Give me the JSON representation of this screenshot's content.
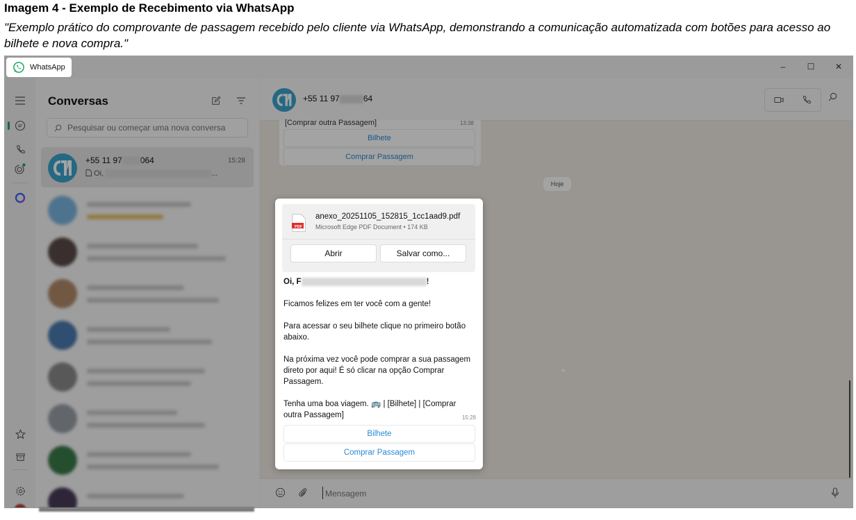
{
  "document": {
    "title": "Imagem 4 - Exemplo de Recebimento via WhatsApp",
    "caption": "\"Exemplo prático do comprovante de passagem recebido pelo cliente via WhatsApp, demonstrando a comunicação automatizada com botões para acesso ao bilhete e nova compra.\""
  },
  "window": {
    "app_name": "WhatsApp",
    "controls": {
      "minimize": "–",
      "maximize": "☐",
      "close": "✕"
    }
  },
  "sidebar": {
    "icons": [
      "menu-icon",
      "chats-icon",
      "calls-icon",
      "status-icon",
      "meta-ai-icon",
      "starred-icon",
      "archived-icon",
      "settings-icon",
      "profile-avatar"
    ]
  },
  "chat_list": {
    "title": "Conversas",
    "search_placeholder": "Pesquisar ou começar uma nova conversa",
    "selected_chat": {
      "name_start": "+55 11 97",
      "name_end": "064",
      "time": "15:28",
      "preview_start": "Oi,",
      "preview_end": "..."
    }
  },
  "chat": {
    "header": {
      "name_start": "+55 11 97",
      "name_end": "64"
    },
    "earlier_bubble": {
      "text": "[Comprar outra Passagem]",
      "time": "13:38",
      "buttons": [
        "Bilhete",
        "Comprar Passagem"
      ]
    },
    "day_separator": "Hoje",
    "composer_placeholder": "Mensagem"
  },
  "popup_message": {
    "attachment": {
      "filename": "anexo_20251105_152815_1cc1aad9.pdf",
      "meta": "Microsoft Edge PDF Document • 174 KB",
      "icon_label": "PDF",
      "open_label": "Abrir",
      "save_label": "Salvar como..."
    },
    "greeting_start": "Oi, F",
    "greeting_end": "!",
    "line1": "Ficamos felizes em ter você com a gente!",
    "line2": "Para acessar o seu bilhete clique no primeiro botão abaixo.",
    "line3": "Na próxima vez você pode comprar a sua passagem direto por aqui! É só clicar na opção Comprar Passagem.",
    "line4": "Tenha uma boa viagem. 🚌 | [Bilhete] | [Comprar outra Passagem]",
    "time": "15:28",
    "buttons": [
      "Bilhete",
      "Comprar Passagem"
    ]
  },
  "colors": {
    "whatsapp_green": "#1daa61",
    "link_blue": "#2a8ad0",
    "avatar_blue": "#3ba3cc",
    "pdf_red": "#e02b2b"
  }
}
